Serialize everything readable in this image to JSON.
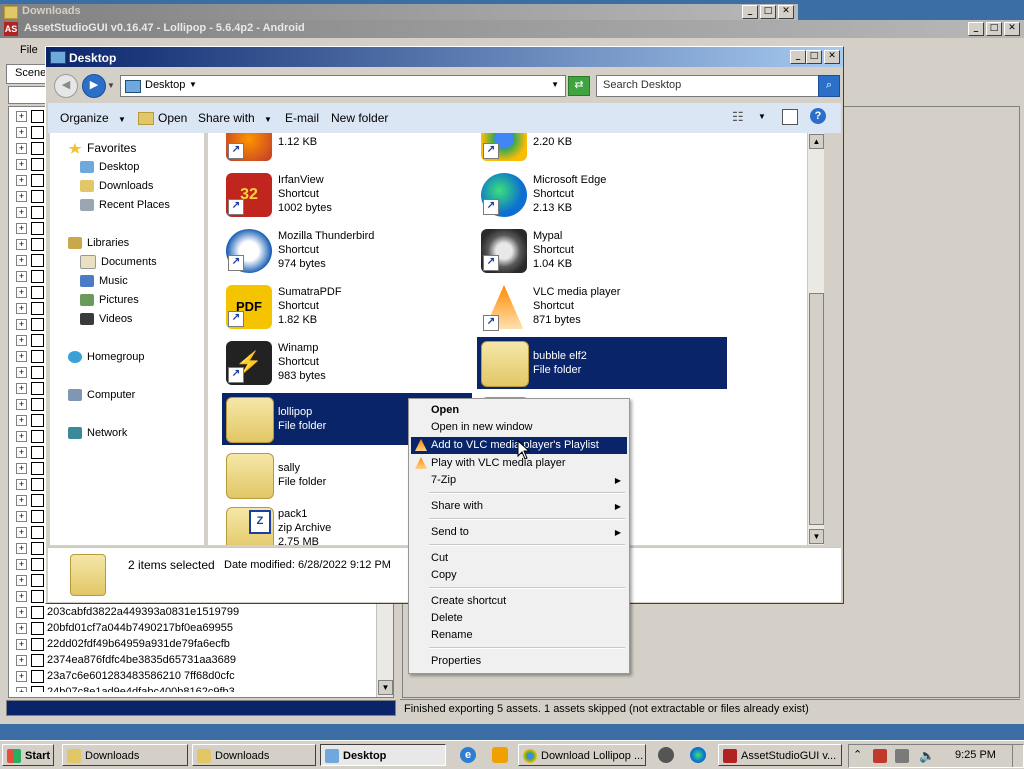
{
  "bg_windows": {
    "downloads_title": "Downloads",
    "asset_title": "AssetStudioGUI v0.16.47 - Lollipop - 5.6.4p2 - Android",
    "asset_menu_file": "File",
    "asset_tab_scene": "Scene",
    "status_text": "Finished exporting 5 assets. 1 assets skipped (not extractable or files already exist)"
  },
  "explorer": {
    "title": "Desktop",
    "address": "Desktop",
    "search_placeholder": "Search Desktop",
    "toolbar": {
      "organize": "Organize",
      "open": "Open",
      "share_with": "Share with",
      "email": "E-mail",
      "new_folder": "New folder"
    },
    "nav": {
      "favorites": "Favorites",
      "desktop": "Desktop",
      "downloads": "Downloads",
      "recent": "Recent Places",
      "libraries": "Libraries",
      "documents": "Documents",
      "music": "Music",
      "pictures": "Pictures",
      "videos": "Videos",
      "homegroup": "Homegroup",
      "computer": "Computer",
      "network": "Network"
    },
    "files": [
      {
        "name": "",
        "type": "",
        "size": "1.12 KB"
      },
      {
        "name": "",
        "type": "",
        "size": "2.20 KB"
      },
      {
        "name": "IrfanView",
        "type": "Shortcut",
        "size": "1002 bytes"
      },
      {
        "name": "Microsoft Edge",
        "type": "Shortcut",
        "size": "2.13 KB"
      },
      {
        "name": "Mozilla Thunderbird",
        "type": "Shortcut",
        "size": "974 bytes"
      },
      {
        "name": "Mypal",
        "type": "Shortcut",
        "size": "1.04 KB"
      },
      {
        "name": "SumatraPDF",
        "type": "Shortcut",
        "size": "1.82 KB"
      },
      {
        "name": "VLC media player",
        "type": "Shortcut",
        "size": "871 bytes"
      },
      {
        "name": "Winamp",
        "type": "Shortcut",
        "size": "983 bytes"
      },
      {
        "name": "bubble elf2",
        "type": "File folder",
        "size": ""
      },
      {
        "name": "lollipop",
        "type": "File folder",
        "size": ""
      },
      {
        "name": "sally",
        "type": "File folder",
        "size": ""
      },
      {
        "name": "pack1",
        "type": "zip Archive",
        "size": "2.75 MB"
      }
    ],
    "details": {
      "selected": "2 items selected",
      "modified": "Date modified: 6/28/2022 9:12 PM"
    }
  },
  "context_menu": {
    "open": "Open",
    "open_new_window": "Open in new window",
    "add_vlc": "Add to VLC media player's Playlist",
    "play_vlc": "Play with VLC media player",
    "seven_zip": "7-Zip",
    "share_with": "Share with",
    "send_to": "Send to",
    "cut": "Cut",
    "copy": "Copy",
    "create_shortcut": "Create shortcut",
    "delete": "Delete",
    "rename": "Rename",
    "properties": "Properties"
  },
  "tree": [
    "203cabfd3822a449393a0831e1519799",
    "20bfd01cf7a044b7490217bf0ea69955",
    "22dd02fdf49b64959a931de79fa6ecfb",
    "2374ea876fdfc4be3835d65731aa3689",
    "23a7c6e601283483586210 7ff68d0cfc",
    "24b07c8e1ad9e4dfabc400b8162c9fb3"
  ],
  "taskbar": {
    "start": "Start",
    "downloads1": "Downloads",
    "downloads2": "Downloads",
    "desktop": "Desktop",
    "download_lollipop": "Download Lollipop ...",
    "assetstudio": "AssetStudioGUI v...",
    "clock": "9:25 PM"
  },
  "colors": {
    "selection": "#0a246a",
    "vlc_orange": "#ff8a00"
  }
}
